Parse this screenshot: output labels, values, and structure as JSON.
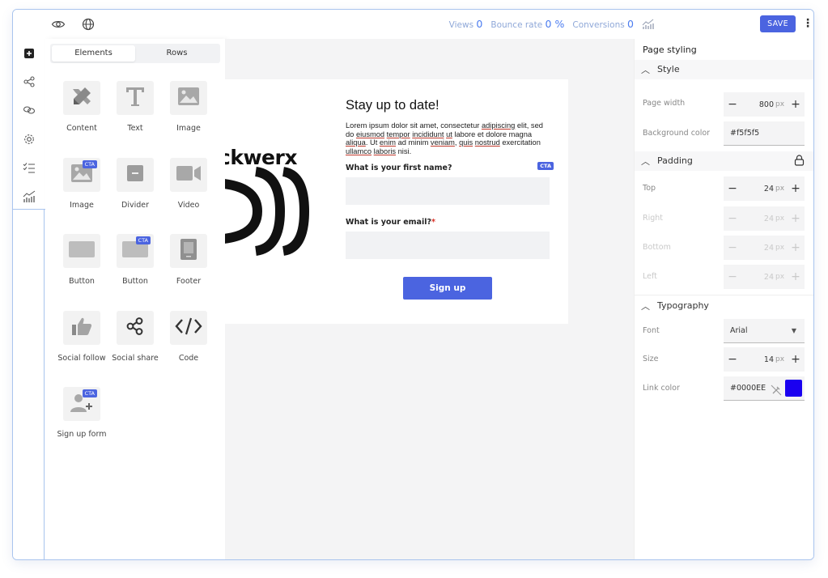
{
  "topbar": {
    "views_label": "Views",
    "views_value": "0",
    "bounce_label": "Bounce rate",
    "bounce_value": "0 %",
    "conversions_label": "Conversions",
    "conversions_value": "0",
    "save_label": "SAVE"
  },
  "elements_panel": {
    "tabs": [
      {
        "label": "Elements"
      },
      {
        "label": "Rows"
      }
    ],
    "badge": "CTA",
    "tiles": [
      {
        "label": "Content"
      },
      {
        "label": "Text"
      },
      {
        "label": "Image"
      },
      {
        "label": "Image"
      },
      {
        "label": "Divider"
      },
      {
        "label": "Video"
      },
      {
        "label": "Button"
      },
      {
        "label": "Button"
      },
      {
        "label": "Footer"
      },
      {
        "label": "Social follow"
      },
      {
        "label": "Social share"
      },
      {
        "label": "Code"
      },
      {
        "label": "Sign up form"
      }
    ]
  },
  "canvas": {
    "logo_text": "ckwerx",
    "form_title": "Stay up to date!",
    "body_parts": [
      "Lorem ipsum dolor sit amet, consectetur ",
      "adipiscing",
      " elit, sed do ",
      "eiusmod",
      " ",
      "tempor",
      " ",
      "incididunt",
      " ",
      "ut",
      " labore et dolore magna ",
      "aliqua",
      ". Ut ",
      "enim",
      " ad minim ",
      "veniam",
      ", ",
      "quis",
      " ",
      "nostrud",
      " exercitation ",
      "ullamco",
      " ",
      "laboris",
      " nisi."
    ],
    "first_name_label": "What is your first name?",
    "email_label": "What is your email?",
    "required_mark": "*",
    "badge": "CTA",
    "signup_label": "Sign up"
  },
  "styling": {
    "title": "Page styling",
    "style_section": "Style",
    "page_width_label": "Page width",
    "page_width_value": "800",
    "unit": "px",
    "bg_color_label": "Background color",
    "bg_color_value": "#f5f5f5",
    "padding_section": "Padding",
    "padding": [
      {
        "label": "Top",
        "value": "24"
      },
      {
        "label": "Right",
        "value": "24"
      },
      {
        "label": "Bottom",
        "value": "24"
      },
      {
        "label": "Left",
        "value": "24"
      }
    ],
    "typography_section": "Typography",
    "font_label": "Font",
    "font_value": "Arial",
    "size_label": "Size",
    "size_value": "14",
    "link_color_label": "Link color",
    "link_color_value": "#0000EE",
    "link_swatch_color": "#1a00f0"
  }
}
